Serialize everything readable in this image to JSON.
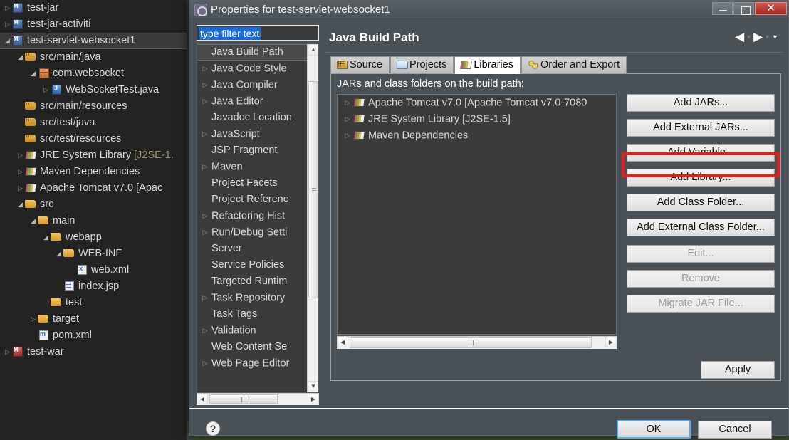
{
  "ide": {
    "explorer": {
      "items": [
        {
          "label": "test-jar",
          "icon": "project-icon",
          "arrow": "collapsed",
          "indent": 0,
          "selected": false
        },
        {
          "label": "test-jar-activiti",
          "icon": "project-icon",
          "arrow": "collapsed",
          "indent": 0,
          "selected": false
        },
        {
          "label": "test-servlet-websocket1",
          "icon": "project-icon",
          "arrow": "expanded",
          "indent": 0,
          "selected": true
        },
        {
          "label": "src/main/java",
          "icon": "source-folder-icon",
          "arrow": "expanded",
          "indent": 1,
          "selected": false
        },
        {
          "label": "com.websocket",
          "icon": "package-icon",
          "arrow": "expanded",
          "indent": 2,
          "selected": false
        },
        {
          "label": "WebSocketTest.java",
          "icon": "java-file-icon",
          "arrow": "collapsed",
          "indent": 3,
          "selected": false
        },
        {
          "label": "src/main/resources",
          "icon": "source-folder-icon",
          "arrow": "none",
          "indent": 1,
          "selected": false
        },
        {
          "label": "src/test/java",
          "icon": "source-folder-icon",
          "arrow": "none",
          "indent": 1,
          "selected": false
        },
        {
          "label": "src/test/resources",
          "icon": "source-folder-icon",
          "arrow": "none",
          "indent": 1,
          "selected": false
        },
        {
          "label": "JRE System Library",
          "suffix": "[J2SE-1.",
          "icon": "library-icon",
          "arrow": "collapsed",
          "indent": 1,
          "selected": false
        },
        {
          "label": "Maven Dependencies",
          "icon": "library-icon",
          "arrow": "collapsed",
          "indent": 1,
          "selected": false
        },
        {
          "label": "Apache Tomcat v7.0 [Apac",
          "icon": "library-icon",
          "arrow": "collapsed",
          "indent": 1,
          "selected": false
        },
        {
          "label": "src",
          "icon": "folder-icon",
          "arrow": "expanded",
          "indent": 1,
          "selected": false
        },
        {
          "label": "main",
          "icon": "folder-icon",
          "arrow": "expanded",
          "indent": 2,
          "selected": false
        },
        {
          "label": "webapp",
          "icon": "folder-icon",
          "arrow": "expanded",
          "indent": 3,
          "selected": false
        },
        {
          "label": "WEB-INF",
          "icon": "folder-icon",
          "arrow": "expanded",
          "indent": 4,
          "selected": false
        },
        {
          "label": "web.xml",
          "icon": "xml-file-icon",
          "arrow": "none",
          "indent": 5,
          "selected": false
        },
        {
          "label": "index.jsp",
          "icon": "jsp-file-icon",
          "arrow": "none",
          "indent": 4,
          "selected": false
        },
        {
          "label": "test",
          "icon": "folder-icon",
          "arrow": "none",
          "indent": 3,
          "selected": false
        },
        {
          "label": "target",
          "icon": "folder-icon",
          "arrow": "collapsed",
          "indent": 2,
          "selected": false
        },
        {
          "label": "pom.xml",
          "icon": "pom-file-icon",
          "arrow": "none",
          "indent": 2,
          "selected": false
        },
        {
          "label": "test-war",
          "icon": "project-war-icon",
          "arrow": "collapsed",
          "indent": 0,
          "selected": false
        }
      ]
    }
  },
  "dialog": {
    "title": "Properties for test-servlet-websocket1",
    "window_controls": {
      "minimize": "minimize-button",
      "maximize": "maximize-button",
      "close": "close-button"
    },
    "filter": {
      "value": "type filter text",
      "placeholder": "type filter text"
    },
    "nav": {
      "items": [
        {
          "label": "Java Build Path",
          "arrow": "none",
          "selected": true
        },
        {
          "label": "Java Code Style",
          "arrow": "collapsed",
          "selected": false
        },
        {
          "label": "Java Compiler",
          "arrow": "collapsed",
          "selected": false
        },
        {
          "label": "Java Editor",
          "arrow": "collapsed",
          "selected": false
        },
        {
          "label": "Javadoc Location",
          "arrow": "none",
          "selected": false
        },
        {
          "label": "JavaScript",
          "arrow": "collapsed",
          "selected": false
        },
        {
          "label": "JSP Fragment",
          "arrow": "none",
          "selected": false
        },
        {
          "label": "Maven",
          "arrow": "collapsed",
          "selected": false
        },
        {
          "label": "Project Facets",
          "arrow": "none",
          "selected": false
        },
        {
          "label": "Project Referenc",
          "arrow": "none",
          "selected": false
        },
        {
          "label": "Refactoring Hist",
          "arrow": "collapsed",
          "selected": false
        },
        {
          "label": "Run/Debug Setti",
          "arrow": "collapsed",
          "selected": false
        },
        {
          "label": "Server",
          "arrow": "none",
          "selected": false
        },
        {
          "label": "Service Policies",
          "arrow": "none",
          "selected": false
        },
        {
          "label": "Targeted Runtim",
          "arrow": "none",
          "selected": false
        },
        {
          "label": "Task Repository",
          "arrow": "collapsed",
          "selected": false
        },
        {
          "label": "Task Tags",
          "arrow": "none",
          "selected": false
        },
        {
          "label": "Validation",
          "arrow": "collapsed",
          "selected": false
        },
        {
          "label": "Web Content Se",
          "arrow": "none",
          "selected": false
        },
        {
          "label": "Web Page Editor",
          "arrow": "collapsed",
          "selected": false
        }
      ]
    },
    "page": {
      "title": "Java Build Path",
      "nav_back": "◀",
      "nav_forward": "▶",
      "tabs": [
        {
          "label": "Source",
          "icon": "source-tab-icon",
          "active": false
        },
        {
          "label": "Projects",
          "icon": "projects-tab-icon",
          "active": false
        },
        {
          "label": "Libraries",
          "icon": "libraries-tab-icon",
          "active": true
        },
        {
          "label": "Order and Export",
          "icon": "order-export-tab-icon",
          "active": false
        }
      ],
      "list_caption": "JARs and class folders on the build path:",
      "entries": [
        {
          "label": "Apache Tomcat v7.0 [Apache Tomcat v7.0-7080",
          "icon": "library-icon",
          "arrow": "collapsed"
        },
        {
          "label": "JRE System Library [J2SE-1.5]",
          "icon": "library-icon",
          "arrow": "collapsed"
        },
        {
          "label": "Maven Dependencies",
          "icon": "library-icon",
          "arrow": "collapsed"
        }
      ],
      "actions": [
        {
          "label": "Add JARs...",
          "disabled": false,
          "highlighted": false
        },
        {
          "label": "Add External JARs...",
          "disabled": false,
          "highlighted": false
        },
        {
          "label": "Add Variable...",
          "disabled": false,
          "highlighted": false
        },
        {
          "label": "Add Library...",
          "disabled": false,
          "highlighted": true
        },
        {
          "label": "Add Class Folder...",
          "disabled": false,
          "highlighted": false
        },
        {
          "label": "Add External Class Folder...",
          "disabled": false,
          "highlighted": false
        },
        {
          "label": "Edit...",
          "disabled": true,
          "highlighted": false
        },
        {
          "label": "Remove",
          "disabled": true,
          "highlighted": false
        },
        {
          "label": "Migrate JAR File...",
          "disabled": true,
          "highlighted": false
        }
      ],
      "apply_label": "Apply"
    },
    "footer": {
      "help_label": "?",
      "ok_label": "OK",
      "cancel_label": "Cancel"
    }
  },
  "colors": {
    "highlight": "#e81c1c",
    "selection_blue": "#1c6ad4",
    "ok_focus": "#4fb0e8",
    "dialog_bg": "#4a5156",
    "list_bg": "#3b3b3b"
  }
}
